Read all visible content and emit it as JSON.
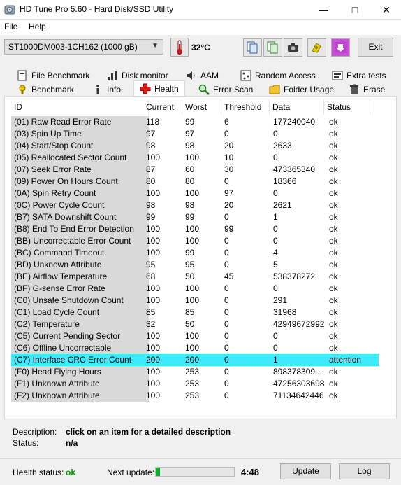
{
  "window": {
    "title": "HD Tune Pro 5.60 - Hard Disk/SSD Utility",
    "icon": "hdtune-app-icon",
    "controls": [
      "minimize-icon",
      "maximize-icon",
      "close-icon"
    ]
  },
  "menu": {
    "items": [
      {
        "label": "File"
      },
      {
        "label": "Help"
      }
    ]
  },
  "toolbar": {
    "drive": "ST1000DM003-1CH162 (1000 gB)",
    "temperature": "32°C",
    "buttons": [
      "copy-info-icon",
      "copy-text-icon",
      "screenshot-camera-icon",
      "options-icon",
      "save-download-icon"
    ],
    "exit_label": "Exit"
  },
  "tabs": {
    "top_row": [
      {
        "label": "File Benchmark",
        "icon": "file-benchmark-icon"
      },
      {
        "label": "Disk monitor",
        "icon": "disk-monitor-icon"
      },
      {
        "label": "AAM",
        "icon": "speaker-icon"
      },
      {
        "label": "Random Access",
        "icon": "random-access-icon"
      },
      {
        "label": "Extra tests",
        "icon": "extra-tests-icon"
      }
    ],
    "bottom_row": [
      {
        "label": "Benchmark",
        "icon": "benchmark-icon"
      },
      {
        "label": "Info",
        "icon": "info-icon"
      },
      {
        "label": "Health",
        "icon": "health-cross-icon",
        "active": true
      },
      {
        "label": "Error Scan",
        "icon": "magnifier-icon"
      },
      {
        "label": "Folder Usage",
        "icon": "folder-icon"
      },
      {
        "label": "Erase",
        "icon": "trash-icon"
      }
    ]
  },
  "table": {
    "columns": [
      "ID",
      "Current",
      "Worst",
      "Threshold",
      "Data",
      "Status"
    ],
    "rows": [
      [
        "(01) Raw Read Error Rate",
        "118",
        "99",
        "6",
        "177240040",
        "ok"
      ],
      [
        "(03) Spin Up Time",
        "97",
        "97",
        "0",
        "0",
        "ok"
      ],
      [
        "(04) Start/Stop Count",
        "98",
        "98",
        "20",
        "2633",
        "ok"
      ],
      [
        "(05) Reallocated Sector Count",
        "100",
        "100",
        "10",
        "0",
        "ok"
      ],
      [
        "(07) Seek Error Rate",
        "87",
        "60",
        "30",
        "473365340",
        "ok"
      ],
      [
        "(09) Power On Hours Count",
        "80",
        "80",
        "0",
        "18366",
        "ok"
      ],
      [
        "(0A) Spin Retry Count",
        "100",
        "100",
        "97",
        "0",
        "ok"
      ],
      [
        "(0C) Power Cycle Count",
        "98",
        "98",
        "20",
        "2621",
        "ok"
      ],
      [
        "(B7) SATA Downshift Count",
        "99",
        "99",
        "0",
        "1",
        "ok"
      ],
      [
        "(B8) End To End Error Detection",
        "100",
        "100",
        "99",
        "0",
        "ok"
      ],
      [
        "(BB) Uncorrectable Error Count",
        "100",
        "100",
        "0",
        "0",
        "ok"
      ],
      [
        "(BC) Command Timeout",
        "100",
        "99",
        "0",
        "4",
        "ok"
      ],
      [
        "(BD) Unknown Attribute",
        "95",
        "95",
        "0",
        "5",
        "ok"
      ],
      [
        "(BE) Airflow Temperature",
        "68",
        "50",
        "45",
        "538378272",
        "ok"
      ],
      [
        "(BF) G-sense Error Rate",
        "100",
        "100",
        "0",
        "0",
        "ok"
      ],
      [
        "(C0) Unsafe Shutdown Count",
        "100",
        "100",
        "0",
        "291",
        "ok"
      ],
      [
        "(C1) Load Cycle Count",
        "85",
        "85",
        "0",
        "31968",
        "ok"
      ],
      [
        "(C2) Temperature",
        "32",
        "50",
        "0",
        "42949672992",
        "ok"
      ],
      [
        "(C5) Current Pending Sector",
        "100",
        "100",
        "0",
        "0",
        "ok"
      ],
      [
        "(C6) Offline Uncorrectable",
        "100",
        "100",
        "0",
        "0",
        "ok"
      ],
      [
        "(C7) Interface CRC Error Count",
        "200",
        "200",
        "0",
        "1",
        "attention"
      ],
      [
        "(F0) Head Flying Hours",
        "100",
        "253",
        "0",
        "898378309...",
        "ok"
      ],
      [
        "(F1) Unknown Attribute",
        "100",
        "253",
        "0",
        "47256303698",
        "ok"
      ],
      [
        "(F2) Unknown Attribute",
        "100",
        "253",
        "0",
        "71134642446",
        "ok"
      ]
    ],
    "selected_row": 20,
    "selected_color": "#3fe9ff"
  },
  "description": {
    "desc_label": "Description:",
    "desc_value": "click on an item for a detailed description",
    "status_label": "Status:",
    "status_value": "n/a"
  },
  "footer": {
    "health_label": "Health status:",
    "health_value": "ok",
    "health_color": "#00a000",
    "next_update_label": "Next update:",
    "progress_fraction": 0.05,
    "countdown": "4:48",
    "update_label": "Update",
    "log_label": "Log"
  }
}
